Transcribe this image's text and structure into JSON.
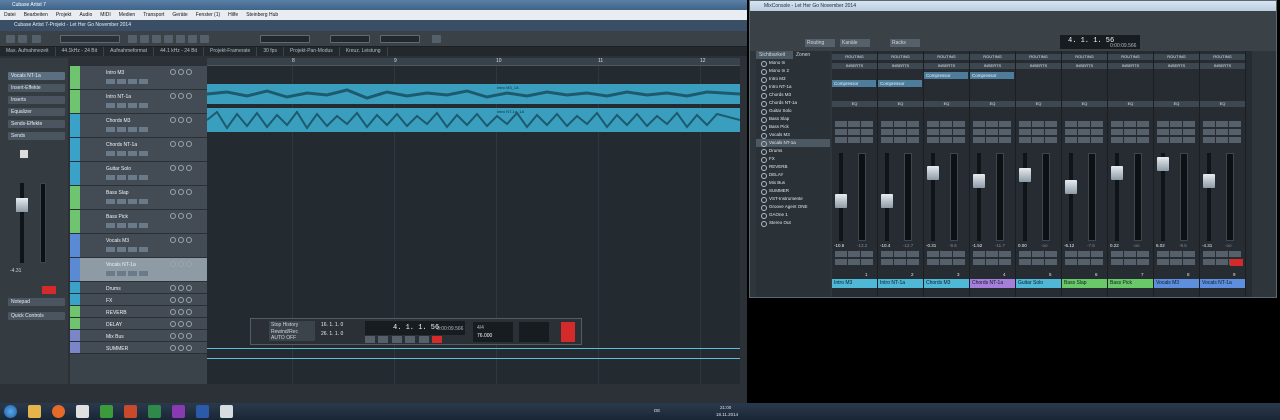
{
  "left_window": {
    "title": "Cubase Artist 7",
    "menu": [
      "Datei",
      "Bearbeiten",
      "Projekt",
      "Audio",
      "MIDI",
      "Medien",
      "Transport",
      "Geräte",
      "Fenster (1)",
      "Hilfe",
      "Steinberg Hub"
    ],
    "project_title": "Cubase Artist 7-Projekt - Let Her Go November 2014",
    "status": [
      "Max. Aufnahmezeit",
      "44.1kHz - 24 Bit",
      "Aufnahmeformat",
      "44.1 kHz - 24 Bit",
      "Projekt-Framerate",
      "30 fps",
      "Projekt-Pan-Modus",
      "Kreuz. Leistung"
    ],
    "inspector_title": "Vocals NT-1a",
    "inspector_sections": [
      "Insert-Effekte",
      "Inserts",
      "Equalizer",
      "Sends-Effekte",
      "Sends",
      "Notepad",
      "Quick Controls"
    ],
    "inspector_value": "-4.31",
    "ruler": [
      "8",
      "9",
      "10",
      "11",
      "12"
    ],
    "tracks": [
      {
        "name": "Intro M3",
        "color": "#6fc46f"
      },
      {
        "name": "Intro NT-1a",
        "color": "#6fc46f"
      },
      {
        "name": "Chords M3",
        "color": "#3aa2c9"
      },
      {
        "name": "Chords NT-1a",
        "color": "#3aa2c9"
      },
      {
        "name": "Guitar Solo",
        "color": "#3aa2c9"
      },
      {
        "name": "Bass Slap",
        "color": "#6fc46f"
      },
      {
        "name": "Bass Pick",
        "color": "#6fc46f"
      },
      {
        "name": "Vocals M3",
        "color": "#5a8ad4"
      },
      {
        "name": "Vocals NT-1a",
        "color": "#5a8ad4"
      },
      {
        "name": "Drums",
        "color": "#3aa2c9"
      },
      {
        "name": "FX",
        "color": "#3aa2c9"
      },
      {
        "name": "REVERB",
        "color": "#6fc46f"
      },
      {
        "name": "DELAY",
        "color": "#6fc46f"
      },
      {
        "name": "Mix Bus",
        "color": "#7a86c7"
      },
      {
        "name": "SUMMER",
        "color": "#7a86c7"
      }
    ],
    "clip_labels": [
      "Intro M3_1A",
      "Intro NT-1a_1A"
    ],
    "transport": {
      "position": "4. 1. 1. 56",
      "time": "0:00:09.566",
      "left": "16. 1. 1. 0",
      "right": "26. 1. 1. 0",
      "tempo": "76.000",
      "signature": "4/4",
      "mode_labels": [
        "Stop History",
        "Rewind/Rec",
        "AUTO",
        "OFF"
      ]
    }
  },
  "right_window": {
    "title": "MixConsole - Let Her Go November 2014",
    "toolbar": {
      "routing": "Routing",
      "kanal": "Kanäle",
      "racks": "Racks",
      "position": "4. 1. 1. 56",
      "time": "0:00:09.566"
    },
    "side_tabs": [
      "Sichtbarkeit",
      "Zonen"
    ],
    "channel_list": [
      "Mono In",
      "Mono In 2",
      "Intro M3",
      "Intro NT-1a",
      "Chords M3",
      "Chords NT-1a",
      "Guitar Solo",
      "Bass Slap",
      "Bass Pick",
      "Vocals M3",
      "Vocals NT-1a",
      "Drums",
      "FX",
      "REVERB",
      "DELAY",
      "Mix Bus",
      "SUMMER",
      "VST-Instrumente",
      "Groove Agent ONE",
      "GAOne 1",
      "Stereo Out"
    ],
    "selected_channel": "Vocals NT-1a",
    "rack_labels": {
      "routing": "ROUTING",
      "inserts": "INSERTS",
      "eq": "EQ"
    },
    "channels": [
      {
        "num": "1",
        "name": "Intro M3",
        "value": "-10.6",
        "peak": "-13.2",
        "color": "#4fb8d6",
        "insert": "Compressor",
        "fader": 0.45
      },
      {
        "num": "2",
        "name": "Intro NT-1a",
        "value": "-10.4",
        "peak": "-12.7",
        "color": "#4fb8d6",
        "insert": "Compressor",
        "fader": 0.44
      },
      {
        "num": "3",
        "name": "Chords M3",
        "value": "-0.31",
        "peak": "-9.6",
        "color": "#4fb8d6",
        "insert": "Compressor",
        "fader": 0.82
      },
      {
        "num": "4",
        "name": "Chords NT-1a",
        "value": "-1.52",
        "peak": "-11.7",
        "color": "#a57fd9",
        "insert": "Compressor",
        "fader": 0.72
      },
      {
        "num": "5",
        "name": "Guitar Solo",
        "value": "0.00",
        "peak": "-oo",
        "color": "#4fb8d6",
        "insert": "",
        "fader": 0.8
      },
      {
        "num": "6",
        "name": "Bass Slap",
        "value": "-6.12",
        "peak": "-7.6",
        "color": "#69c969",
        "insert": "",
        "fader": 0.64
      },
      {
        "num": "7",
        "name": "Bass Pick",
        "value": "0.22",
        "peak": "-oo",
        "color": "#69c969",
        "insert": "",
        "fader": 0.82
      },
      {
        "num": "8",
        "name": "Vocals M3",
        "value": "6.02",
        "peak": "-9.6",
        "color": "#5d8fde",
        "insert": "",
        "fader": 0.95
      },
      {
        "num": "9",
        "name": "Vocals NT-1a",
        "value": "-4.31",
        "peak": "-oo",
        "color": "#5d8fde",
        "insert": "",
        "fader": 0.72
      }
    ]
  },
  "taskbar": {
    "language": "DE",
    "time": "21:00",
    "date": "18.11.2014"
  },
  "colors": {
    "accent": "#3aa2c9",
    "clip": "#3a9fbf",
    "record": "#d42a2a"
  }
}
